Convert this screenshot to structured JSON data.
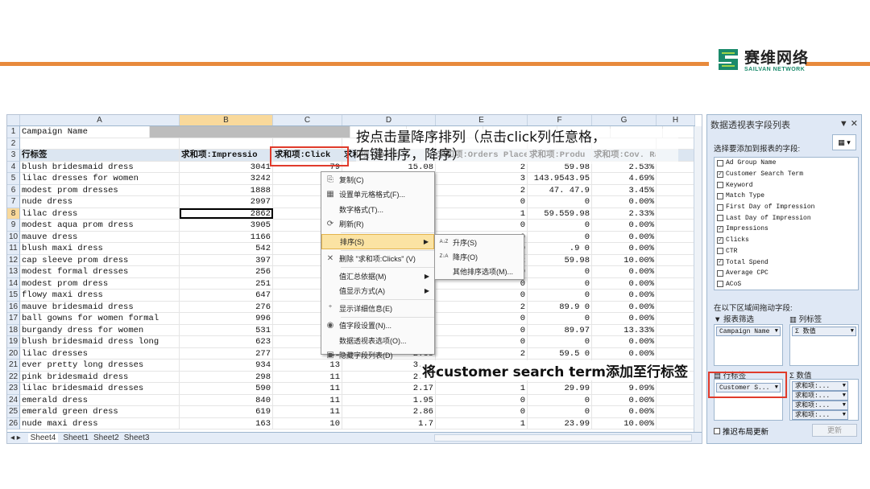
{
  "brand": {
    "name_cn": "赛维网络",
    "name_en": "SAILVAN NETWORK",
    "accent": "#e88a3c",
    "logo_green": "#1b8a6b"
  },
  "excel": {
    "columns": [
      "A",
      "B",
      "C",
      "D",
      "E",
      "F",
      "G",
      "H"
    ],
    "row_numbers": [
      "1",
      "2",
      "3",
      "4",
      "5",
      "6",
      "7",
      "8",
      "9",
      "10",
      "11",
      "12",
      "13",
      "14",
      "15",
      "16",
      "17",
      "18",
      "19",
      "20",
      "21",
      "22",
      "23",
      "24",
      "25",
      "26"
    ],
    "rows": [
      [
        "Campaign Name",
        "",
        "",
        "",
        "",
        "",
        "",
        ""
      ],
      [
        "",
        "",
        "",
        "",
        "",
        "",
        "",
        ""
      ],
      [
        "行标签",
        "求和项:Impressio",
        "求和项:Click",
        "求和项:Spend",
        "求和项:Orders Placed",
        "求和项:Produ",
        "求和项:Cov. Rate",
        ""
      ],
      [
        "blush bridesmaid dress",
        "3041",
        "79",
        "15.08",
        "2",
        "59.98",
        "2.53%",
        ""
      ],
      [
        "lilac dresses for women",
        "3242",
        "",
        "",
        "3",
        "143.9543.95",
        "4.69%",
        ""
      ],
      [
        "modest prom dresses",
        "1888",
        "",
        "",
        "2",
        "47. 47.9",
        "3.45%",
        ""
      ],
      [
        "nude dress",
        "2997",
        "",
        "",
        "0",
        "0",
        "0.00%",
        ""
      ],
      [
        "lilac dress",
        "2862",
        "",
        "",
        "1",
        "59.559.98",
        "2.33%",
        ""
      ],
      [
        "modest aqua prom dress",
        "3905",
        "",
        "",
        "0",
        "0",
        "0.00%",
        ""
      ],
      [
        "mauve dress",
        "1166",
        "",
        "",
        "0",
        "0",
        "0.00%",
        ""
      ],
      [
        "blush maxi dress",
        "542",
        "",
        "",
        "0",
        ".9 0",
        "0.00%",
        ""
      ],
      [
        "cap sleeve prom dress",
        "397",
        "",
        "",
        "2",
        "59.98",
        "10.00%",
        ""
      ],
      [
        "modest formal dresses",
        "256",
        "",
        "",
        "0",
        "0",
        "0.00%",
        ""
      ],
      [
        "modest prom dress",
        "251",
        "",
        "",
        "0",
        "0",
        "0.00%",
        ""
      ],
      [
        "flowy maxi dress",
        "647",
        "",
        "",
        "0",
        "0",
        "0.00%",
        ""
      ],
      [
        "mauve bridesmaid dress",
        "276",
        "",
        "",
        "2",
        "89.9 0",
        "0.00%",
        ""
      ],
      [
        "ball gowns for women formal",
        "996",
        "",
        "",
        "0",
        "0",
        "0.00%",
        ""
      ],
      [
        "burgandy dress for women",
        "531",
        "",
        "",
        "0",
        "89.97",
        "13.33%",
        ""
      ],
      [
        "blush bridesmaid dress long",
        "623",
        "",
        "",
        "0",
        "0",
        "0.00%",
        ""
      ],
      [
        "lilac dresses",
        "277",
        "13",
        "2.38",
        "2",
        "59.5 0",
        "0.00%",
        ""
      ],
      [
        "ever pretty long dresses",
        "934",
        "13",
        "3.63",
        "0",
        "0",
        "0.00%",
        ""
      ],
      [
        "pink bridesmaid dress",
        "298",
        "11",
        "2.81",
        "2",
        "59.98",
        "18.18%",
        ""
      ],
      [
        "lilac bridesmaid dresses",
        "590",
        "11",
        "2.17",
        "1",
        "29.99",
        "9.09%",
        ""
      ],
      [
        "emerald dress",
        "840",
        "11",
        "1.95",
        "0",
        "0",
        "0.00%",
        ""
      ],
      [
        "emerald green dress",
        "619",
        "11",
        "2.86",
        "0",
        "0",
        "0.00%",
        ""
      ],
      [
        "nude maxi dress",
        "163",
        "10",
        "1.7",
        "1",
        "23.99",
        "10.00%",
        ""
      ]
    ],
    "sheet_tabs": [
      "Sheet4",
      "Sheet1",
      "Sheet2",
      "Sheet3"
    ]
  },
  "context_menu": {
    "items": [
      "复制(C)",
      "设置单元格格式(F)...",
      "数字格式(T)...",
      "刷新(R)",
      "排序(S)",
      "删除 \"求和项:Clicks\" (V)",
      "值汇总依据(M)",
      "值显示方式(A)",
      "显示详细信息(E)",
      "值字段设置(N)...",
      "数据透视表选项(O)...",
      "隐藏字段列表(D)"
    ],
    "submenu": [
      "升序(S)",
      "降序(O)",
      "其他排序选项(M)..."
    ]
  },
  "annotations": {
    "top": "按点击量降序排列（点击click列任意格，\n右键排序，降序）",
    "bottom": "将customer search term添加至行标签"
  },
  "pivot_panel": {
    "title": "数据透视表字段列表",
    "choose_label": "选择要添加到报表的字段:",
    "fields": [
      {
        "name": "Ad Group Name",
        "checked": false
      },
      {
        "name": "Customer Search Term",
        "checked": true
      },
      {
        "name": "Keyword",
        "checked": false
      },
      {
        "name": "Match Type",
        "checked": false
      },
      {
        "name": "First Day of Impression",
        "checked": false
      },
      {
        "name": "Last Day of Impression",
        "checked": false
      },
      {
        "name": "Impressions",
        "checked": true
      },
      {
        "name": "Clicks",
        "checked": true
      },
      {
        "name": "CTR",
        "checked": false
      },
      {
        "name": "Total Spend",
        "checked": true
      },
      {
        "name": "Average CPC",
        "checked": false
      },
      {
        "name": "ACoS",
        "checked": false
      }
    ],
    "drag_label": "在以下区域间拖动字段:",
    "report_filter_label": "报表筛选",
    "column_label": "列标签",
    "row_label": "行标签",
    "values_label": "数值",
    "filter_chip": "Campaign Name",
    "column_chip": "数值",
    "row_chip": "Customer S...",
    "value_chips": [
      "求和项:...",
      "求和项:...",
      "求和项:...",
      "求和项:..."
    ],
    "defer_label": "推迟布局更新",
    "update_button": "更新"
  }
}
